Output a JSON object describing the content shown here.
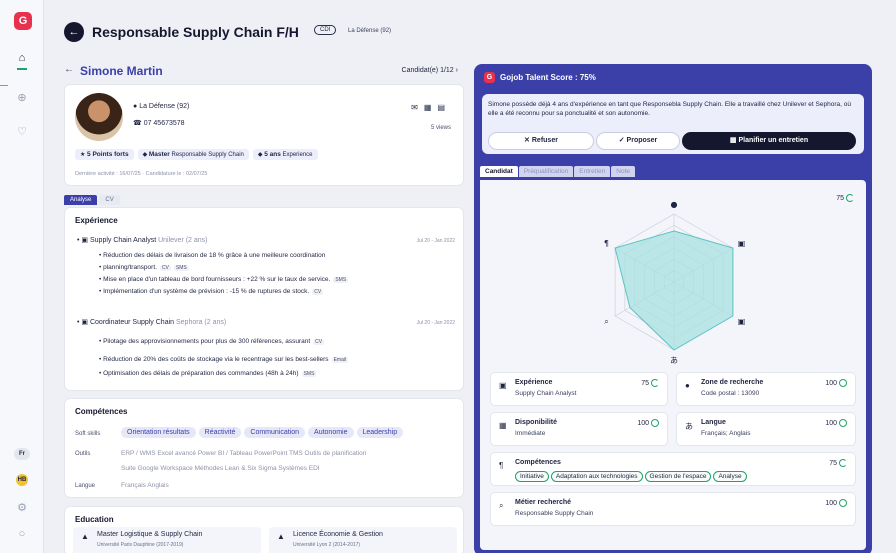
{
  "rail": {
    "logo": "G",
    "badges": [
      "Fr",
      "HB"
    ]
  },
  "header": {
    "title": "Responsable Supply Chain F/H",
    "contract": "CDI",
    "location": "La Défense (92)"
  },
  "candidate": {
    "name": "Simone Martin",
    "counter": "Candidat(e) 1/12",
    "location": "La Défense (92)",
    "phone": "07 45673578",
    "views": "5 views",
    "tags": [
      {
        "strong": "5 Points forts",
        "text": ""
      },
      {
        "strong": "Master",
        "text": "Responsable Supply Chain"
      },
      {
        "strong": "5 ans",
        "text": "Experience"
      }
    ],
    "activity": "Dernière activité : 16/07/25 · Candidature le : 02/07/25"
  },
  "left_tabs": [
    "Analyse",
    "CV"
  ],
  "experience": {
    "title": "Expérience",
    "jobs": [
      {
        "role": "Supply Chain Analyst",
        "company": "Unilever (2 ans)",
        "date": "Jul 20 - Jan 2022",
        "bullets": [
          {
            "text": "Réduction des délais de livraison de 18 % grâce à une meilleure coordination",
            "chips": []
          },
          {
            "text": "planning/transport.",
            "chips": [
              "CV",
              "SMS"
            ]
          },
          {
            "text": "Mise en place d'un tableau de bord fournisseurs : +22 % sur le taux de service.",
            "chips": [
              "SMS"
            ]
          },
          {
            "text": "Implémentation d'un système de prévision : -15 % de ruptures de stock.",
            "chips": [
              "CV"
            ]
          }
        ]
      },
      {
        "role": "Coordinateur Supply Chain",
        "company": "Sephora (2 ans)",
        "date": "Jul 20 - Jan 2022",
        "bullets": [
          {
            "text": "Pilotage des approvisionnements pour plus de 300 références, assurant",
            "chips": [
              "CV"
            ]
          },
          {
            "text": "Réduction de 20% des coûts de stockage via le recentrage sur les best-sellers",
            "chips": [
              "Email"
            ]
          },
          {
            "text": "Optimisation des délais de préparation des commandes (48h à 24h)",
            "chips": [
              "SMS"
            ]
          }
        ]
      }
    ]
  },
  "skills": {
    "title": "Compétences",
    "soft_label": "Soft skills",
    "soft": [
      "Orientation résultats",
      "Réactivité",
      "Communication",
      "Autonomie",
      "Leadership"
    ],
    "tools_label": "Outils",
    "tools_line1": "ERP / WMS  Excel avancé  Power BI / Tableau  PowerPoint  TMS  Outils de planification",
    "tools_line2": "Suite Google Workspace  Méthodes Lean & Six Sigma  Systèmes EDI",
    "lang_label": "Langue",
    "langs": "Français  Anglais"
  },
  "education": {
    "title": "Education",
    "items": [
      {
        "title": "Master Logistique & Supply Chain",
        "sub": "Université Paris Dauphine (2017-2019)"
      },
      {
        "title": "Licence Économie & Gestion",
        "sub": "Université Lyon 2 (2014-2017)"
      }
    ]
  },
  "talent": {
    "title": "Gojob Talent Score : 75%",
    "summary": "Simone possède déjà 4 ans d'expérience en tant que Responsebla Supply Chain. Elle a travaillé chez Unilever et Sephora, où elle a été reconnu pour sa ponctualité et son autonomie.",
    "refuse": "Refuser",
    "propose": "Proposer",
    "plan": "Planifier un entretien",
    "tabs": [
      "Candidat",
      "Préqualification",
      "Entretien",
      "Note"
    ],
    "overall_score": "75",
    "radar_values": [
      0.75,
      1.0,
      1.0,
      1.0,
      0.75,
      1.0
    ],
    "criteria": {
      "experience": {
        "name": "Expérience",
        "value": "Supply Chain Analyst",
        "score": "75"
      },
      "zone": {
        "name": "Zone de recherche",
        "value": "Code postal : 13090",
        "score": "100"
      },
      "dispo": {
        "name": "Disponibilité",
        "value": "Immédiate",
        "score": "100"
      },
      "langue": {
        "name": "Langue",
        "value": "Français; Anglais",
        "score": "100"
      },
      "competences": {
        "name": "Compétences",
        "score": "75",
        "tags": [
          "Initiative",
          "Adaptation aux technologies",
          "Gestion de l'espace",
          "Analyse"
        ]
      },
      "metier": {
        "name": "Métier recherché",
        "value": "Responsable Supply Chain",
        "score": "100"
      }
    }
  },
  "colors": {
    "primary": "#3b3fa8",
    "brand": "#e8324d",
    "success": "#1fa36b",
    "dark": "#14172e"
  }
}
